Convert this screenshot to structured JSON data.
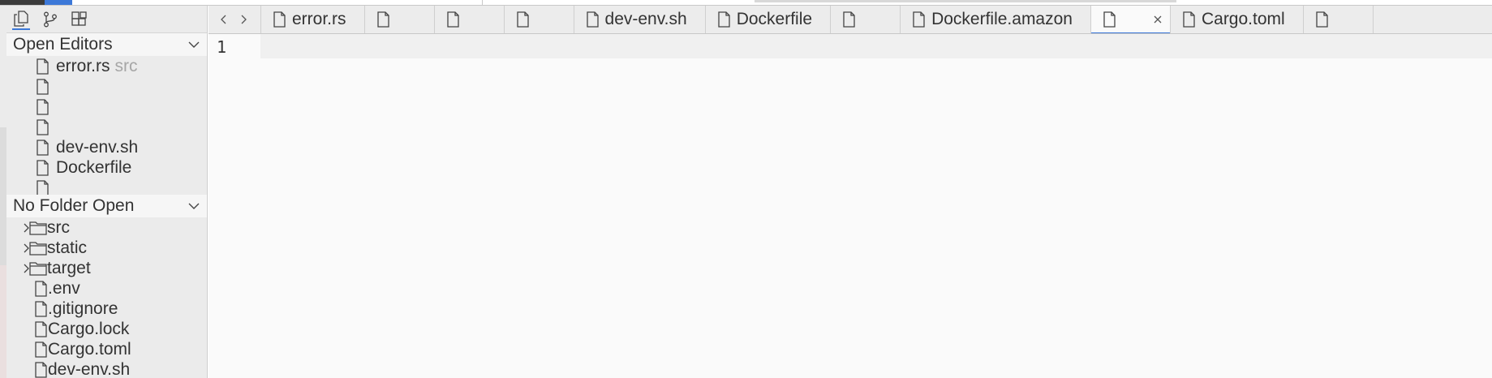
{
  "sidebar": {
    "activity": [
      {
        "icon": "explorer-icon",
        "active": true
      },
      {
        "icon": "source-control-icon",
        "active": false
      },
      {
        "icon": "extensions-icon",
        "active": false
      }
    ],
    "open_editors": {
      "title": "Open Editors",
      "items": [
        {
          "name": "error.rs",
          "hint": "src"
        },
        {
          "name": "",
          "hint": ""
        },
        {
          "name": "",
          "hint": ""
        },
        {
          "name": "",
          "hint": ""
        },
        {
          "name": "dev-env.sh",
          "hint": ""
        },
        {
          "name": "Dockerfile",
          "hint": ""
        },
        {
          "name": "",
          "hint": ""
        }
      ]
    },
    "folder": {
      "title": "No Folder Open",
      "items": [
        {
          "type": "folder",
          "name": "src"
        },
        {
          "type": "folder",
          "name": "static"
        },
        {
          "type": "folder",
          "name": "target"
        },
        {
          "type": "file",
          "name": ".env"
        },
        {
          "type": "file",
          "name": ".gitignore"
        },
        {
          "type": "file",
          "name": "Cargo.lock"
        },
        {
          "type": "file",
          "name": "Cargo.toml"
        },
        {
          "type": "file",
          "name": "dev-env.sh"
        }
      ]
    }
  },
  "tabs": [
    {
      "label": "error.rs",
      "active": false
    },
    {
      "label": "",
      "active": false
    },
    {
      "label": "",
      "active": false
    },
    {
      "label": "",
      "active": false
    },
    {
      "label": "dev-env.sh",
      "active": false
    },
    {
      "label": "Dockerfile",
      "active": false
    },
    {
      "label": "",
      "active": false
    },
    {
      "label": "Dockerfile.amazon",
      "active": false
    },
    {
      "label": "",
      "active": true
    },
    {
      "label": "Cargo.toml",
      "active": false
    },
    {
      "label": "",
      "active": false
    }
  ],
  "editor": {
    "line_numbers": [
      "1"
    ]
  },
  "colors": {
    "accent": "#3c78d8",
    "sidebar_bg": "#ebebeb",
    "editor_bg": "#fafafa"
  }
}
